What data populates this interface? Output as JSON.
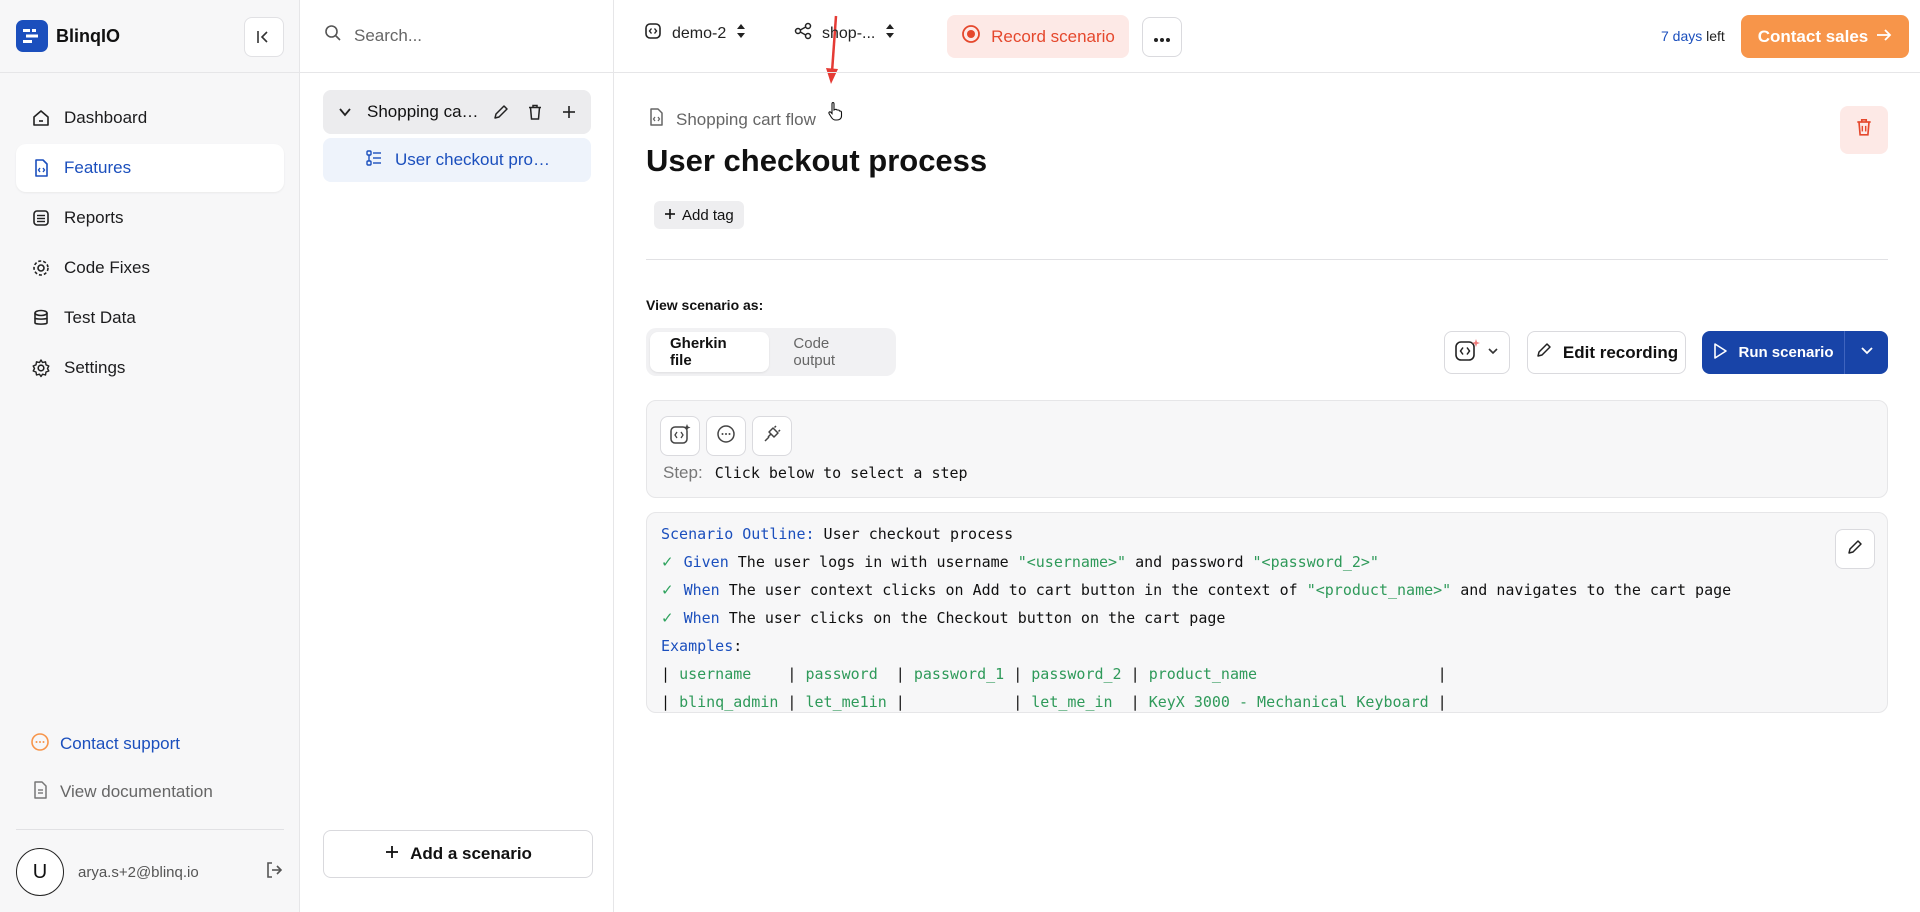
{
  "brand": {
    "name": "BlinqIO"
  },
  "nav": {
    "items": [
      {
        "label": "Dashboard",
        "icon": "home-icon"
      },
      {
        "label": "Features",
        "icon": "feature-file-icon"
      },
      {
        "label": "Reports",
        "icon": "list-icon"
      },
      {
        "label": "Code Fixes",
        "icon": "gear-icon"
      },
      {
        "label": "Test Data",
        "icon": "database-icon"
      },
      {
        "label": "Settings",
        "icon": "settings-icon"
      }
    ],
    "support": "Contact support",
    "docs": "View documentation"
  },
  "user": {
    "initial": "U",
    "email": "arya.s+2@blinq.io"
  },
  "tree": {
    "search_placeholder": "Search...",
    "feature": "Shopping cart flow",
    "scenario": "User checkout process",
    "add_scenario": "Add a scenario"
  },
  "topbar": {
    "project": "demo-2",
    "app": "shop-...",
    "record": "Record scenario",
    "trial_days": "7 days",
    "trial_suffix": "left",
    "contact_sales": "Contact sales"
  },
  "main": {
    "breadcrumb": "Shopping cart flow",
    "title": "User checkout process",
    "add_tag": "Add tag",
    "view_as": "View scenario as:",
    "tabs": [
      "Gherkin file",
      "Code output"
    ],
    "edit_recording": "Edit recording",
    "run_scenario": "Run scenario",
    "step_label": "Step:",
    "step_value": "Click below to select a step"
  },
  "gherkin": {
    "outline_kw": "Scenario Outline:",
    "outline_name": " User checkout process",
    "steps": [
      {
        "kw": "Given",
        "parts": [
          " The user logs in with username ",
          "\"<username>\"",
          " and password ",
          "\"<password_2>\""
        ]
      },
      {
        "kw": "When",
        "parts": [
          " The user context clicks on Add to cart button in the context of ",
          "\"<product_name>\"",
          " and navigates to the cart page"
        ]
      },
      {
        "kw": "When",
        "parts": [
          " The user clicks on the Checkout button on the cart page"
        ]
      }
    ],
    "examples_kw": "Examples",
    "examples_colon": ":",
    "header_row": [
      "username   ",
      "password ",
      "password_1",
      "password_2",
      "product_name                 "
    ],
    "data_row": [
      "blinq_admin",
      "let_me1in",
      "          ",
      "let_me_in ",
      "KeyX 3000 - Mechanical Keyboard"
    ]
  }
}
